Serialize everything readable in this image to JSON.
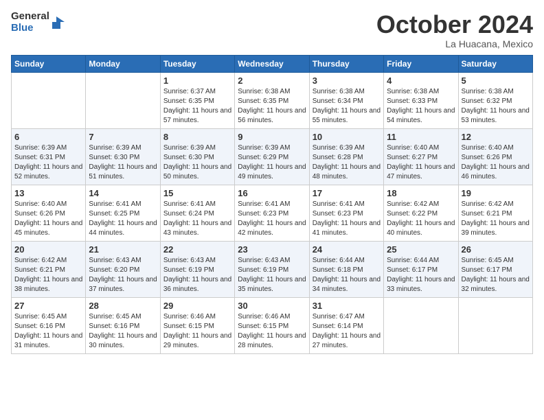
{
  "logo": {
    "general": "General",
    "blue": "Blue"
  },
  "header": {
    "month": "October 2024",
    "location": "La Huacana, Mexico"
  },
  "weekdays": [
    "Sunday",
    "Monday",
    "Tuesday",
    "Wednesday",
    "Thursday",
    "Friday",
    "Saturday"
  ],
  "weeks": [
    [
      {
        "day": "",
        "sunrise": "",
        "sunset": "",
        "daylight": ""
      },
      {
        "day": "",
        "sunrise": "",
        "sunset": "",
        "daylight": ""
      },
      {
        "day": "1",
        "sunrise": "Sunrise: 6:37 AM",
        "sunset": "Sunset: 6:35 PM",
        "daylight": "Daylight: 11 hours and 57 minutes."
      },
      {
        "day": "2",
        "sunrise": "Sunrise: 6:38 AM",
        "sunset": "Sunset: 6:35 PM",
        "daylight": "Daylight: 11 hours and 56 minutes."
      },
      {
        "day": "3",
        "sunrise": "Sunrise: 6:38 AM",
        "sunset": "Sunset: 6:34 PM",
        "daylight": "Daylight: 11 hours and 55 minutes."
      },
      {
        "day": "4",
        "sunrise": "Sunrise: 6:38 AM",
        "sunset": "Sunset: 6:33 PM",
        "daylight": "Daylight: 11 hours and 54 minutes."
      },
      {
        "day": "5",
        "sunrise": "Sunrise: 6:38 AM",
        "sunset": "Sunset: 6:32 PM",
        "daylight": "Daylight: 11 hours and 53 minutes."
      }
    ],
    [
      {
        "day": "6",
        "sunrise": "Sunrise: 6:39 AM",
        "sunset": "Sunset: 6:31 PM",
        "daylight": "Daylight: 11 hours and 52 minutes."
      },
      {
        "day": "7",
        "sunrise": "Sunrise: 6:39 AM",
        "sunset": "Sunset: 6:30 PM",
        "daylight": "Daylight: 11 hours and 51 minutes."
      },
      {
        "day": "8",
        "sunrise": "Sunrise: 6:39 AM",
        "sunset": "Sunset: 6:30 PM",
        "daylight": "Daylight: 11 hours and 50 minutes."
      },
      {
        "day": "9",
        "sunrise": "Sunrise: 6:39 AM",
        "sunset": "Sunset: 6:29 PM",
        "daylight": "Daylight: 11 hours and 49 minutes."
      },
      {
        "day": "10",
        "sunrise": "Sunrise: 6:39 AM",
        "sunset": "Sunset: 6:28 PM",
        "daylight": "Daylight: 11 hours and 48 minutes."
      },
      {
        "day": "11",
        "sunrise": "Sunrise: 6:40 AM",
        "sunset": "Sunset: 6:27 PM",
        "daylight": "Daylight: 11 hours and 47 minutes."
      },
      {
        "day": "12",
        "sunrise": "Sunrise: 6:40 AM",
        "sunset": "Sunset: 6:26 PM",
        "daylight": "Daylight: 11 hours and 46 minutes."
      }
    ],
    [
      {
        "day": "13",
        "sunrise": "Sunrise: 6:40 AM",
        "sunset": "Sunset: 6:26 PM",
        "daylight": "Daylight: 11 hours and 45 minutes."
      },
      {
        "day": "14",
        "sunrise": "Sunrise: 6:41 AM",
        "sunset": "Sunset: 6:25 PM",
        "daylight": "Daylight: 11 hours and 44 minutes."
      },
      {
        "day": "15",
        "sunrise": "Sunrise: 6:41 AM",
        "sunset": "Sunset: 6:24 PM",
        "daylight": "Daylight: 11 hours and 43 minutes."
      },
      {
        "day": "16",
        "sunrise": "Sunrise: 6:41 AM",
        "sunset": "Sunset: 6:23 PM",
        "daylight": "Daylight: 11 hours and 42 minutes."
      },
      {
        "day": "17",
        "sunrise": "Sunrise: 6:41 AM",
        "sunset": "Sunset: 6:23 PM",
        "daylight": "Daylight: 11 hours and 41 minutes."
      },
      {
        "day": "18",
        "sunrise": "Sunrise: 6:42 AM",
        "sunset": "Sunset: 6:22 PM",
        "daylight": "Daylight: 11 hours and 40 minutes."
      },
      {
        "day": "19",
        "sunrise": "Sunrise: 6:42 AM",
        "sunset": "Sunset: 6:21 PM",
        "daylight": "Daylight: 11 hours and 39 minutes."
      }
    ],
    [
      {
        "day": "20",
        "sunrise": "Sunrise: 6:42 AM",
        "sunset": "Sunset: 6:21 PM",
        "daylight": "Daylight: 11 hours and 38 minutes."
      },
      {
        "day": "21",
        "sunrise": "Sunrise: 6:43 AM",
        "sunset": "Sunset: 6:20 PM",
        "daylight": "Daylight: 11 hours and 37 minutes."
      },
      {
        "day": "22",
        "sunrise": "Sunrise: 6:43 AM",
        "sunset": "Sunset: 6:19 PM",
        "daylight": "Daylight: 11 hours and 36 minutes."
      },
      {
        "day": "23",
        "sunrise": "Sunrise: 6:43 AM",
        "sunset": "Sunset: 6:19 PM",
        "daylight": "Daylight: 11 hours and 35 minutes."
      },
      {
        "day": "24",
        "sunrise": "Sunrise: 6:44 AM",
        "sunset": "Sunset: 6:18 PM",
        "daylight": "Daylight: 11 hours and 34 minutes."
      },
      {
        "day": "25",
        "sunrise": "Sunrise: 6:44 AM",
        "sunset": "Sunset: 6:17 PM",
        "daylight": "Daylight: 11 hours and 33 minutes."
      },
      {
        "day": "26",
        "sunrise": "Sunrise: 6:45 AM",
        "sunset": "Sunset: 6:17 PM",
        "daylight": "Daylight: 11 hours and 32 minutes."
      }
    ],
    [
      {
        "day": "27",
        "sunrise": "Sunrise: 6:45 AM",
        "sunset": "Sunset: 6:16 PM",
        "daylight": "Daylight: 11 hours and 31 minutes."
      },
      {
        "day": "28",
        "sunrise": "Sunrise: 6:45 AM",
        "sunset": "Sunset: 6:16 PM",
        "daylight": "Daylight: 11 hours and 30 minutes."
      },
      {
        "day": "29",
        "sunrise": "Sunrise: 6:46 AM",
        "sunset": "Sunset: 6:15 PM",
        "daylight": "Daylight: 11 hours and 29 minutes."
      },
      {
        "day": "30",
        "sunrise": "Sunrise: 6:46 AM",
        "sunset": "Sunset: 6:15 PM",
        "daylight": "Daylight: 11 hours and 28 minutes."
      },
      {
        "day": "31",
        "sunrise": "Sunrise: 6:47 AM",
        "sunset": "Sunset: 6:14 PM",
        "daylight": "Daylight: 11 hours and 27 minutes."
      },
      {
        "day": "",
        "sunrise": "",
        "sunset": "",
        "daylight": ""
      },
      {
        "day": "",
        "sunrise": "",
        "sunset": "",
        "daylight": ""
      }
    ]
  ]
}
